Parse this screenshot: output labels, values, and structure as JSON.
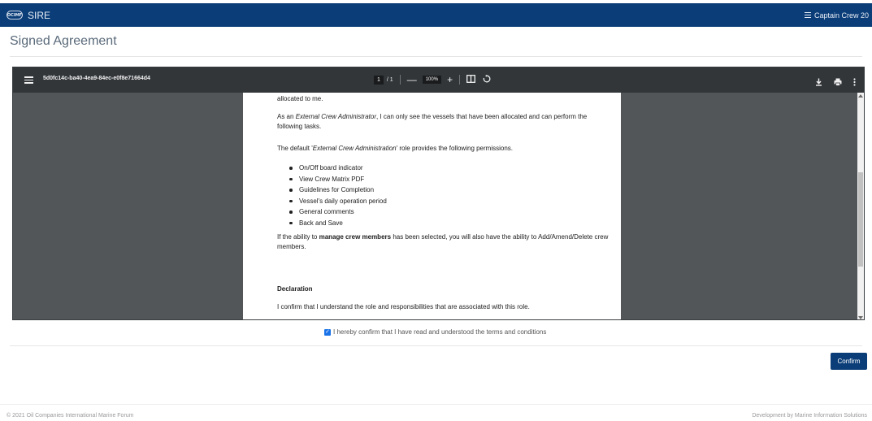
{
  "header": {
    "logo_text": "OCIMF",
    "app_name": "SIRE",
    "user_label": "Captain Crew 20"
  },
  "page": {
    "title": "Signed Agreement"
  },
  "viewer": {
    "document_id": "5d0fc14c-ba40-4ea9-84ec-e0f8e71664d4",
    "page_current": "1",
    "page_total": "/ 1",
    "zoom": "100%",
    "zoom_out": "—",
    "zoom_in": "+",
    "content": {
      "line1": "allocated to me.",
      "para2": "As an External Crew Administrator, I can only see the vessels that have been allocated and can perform the following tasks.",
      "para3": "The default 'External Crew Administration' role provides the following permissions.",
      "bullets": [
        "On/Off board indicator",
        "View Crew Matrix PDF",
        "Guidelines for Completion",
        "Vessel's daily operation period",
        "General comments",
        "Back and Save"
      ],
      "para4_pre": "If the ability to ",
      "para4_bold": "manage crew members",
      "para4_post": " has been selected, you will also have the ability to Add/Amend/Delete crew members.",
      "declaration_heading": "Declaration",
      "declaration_text": "I confirm that I understand the role and responsibilities that are associated with this role."
    }
  },
  "agreement": {
    "checkbox_checked": true,
    "checkbox_label": "I hereby confirm that I have read and understood the terms and conditions",
    "confirm_button": "Confirm"
  },
  "footer": {
    "left": "© 2021 Oil Companies International Marine Forum",
    "right": "Development by Marine Information Solutions"
  },
  "colors": {
    "brand": "#0b3d78",
    "viewer_bg": "#525659",
    "viewer_toolbar": "#323639"
  },
  "icons": [
    "hamburger-icon",
    "menu-icon",
    "fit-page-icon",
    "rotate-icon",
    "download-icon",
    "print-icon",
    "more-icon"
  ]
}
